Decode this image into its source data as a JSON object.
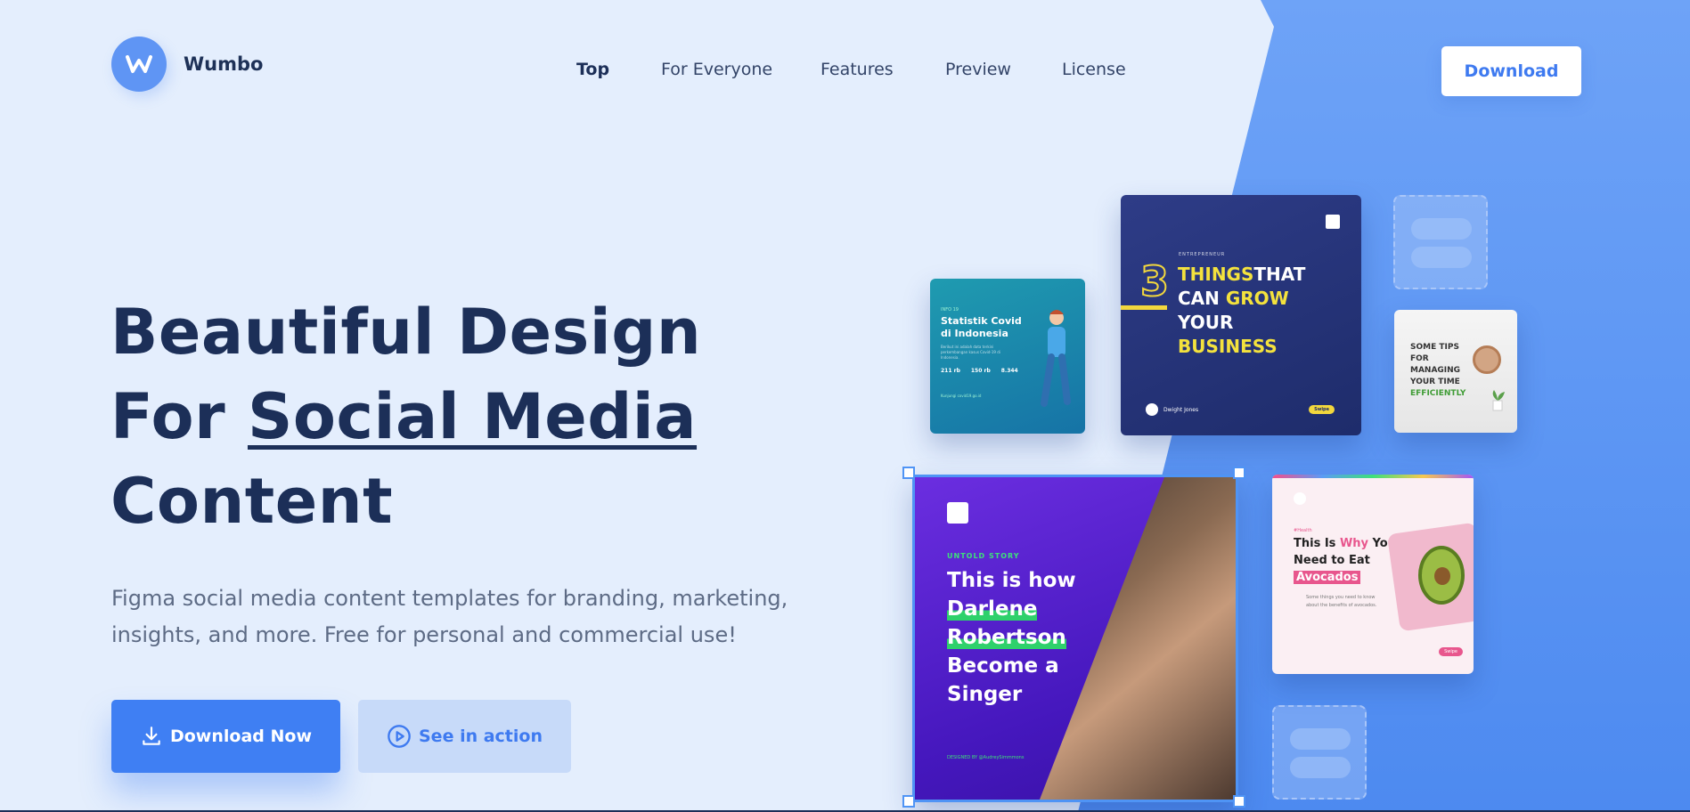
{
  "brand": {
    "name": "Wumbo",
    "logo_letter": "W"
  },
  "nav": [
    {
      "label": "Top",
      "active": true
    },
    {
      "label": "For Everyone",
      "active": false
    },
    {
      "label": "Features",
      "active": false
    },
    {
      "label": "Preview",
      "active": false
    },
    {
      "label": "License",
      "active": false
    }
  ],
  "header_button": "Download",
  "hero": {
    "line1": "Beautiful Design",
    "line2_prefix": "For ",
    "line2_emphasis": "Social Media",
    "line3": "Content",
    "description": "Figma social media content templates for branding, marketing, insights, and more. Free for personal and commercial use!"
  },
  "buttons": {
    "primary": "Download Now",
    "secondary": "See in action"
  },
  "cards": {
    "covid": {
      "kicker": "INFO 19",
      "title": "Statistik Covid di Indonesia",
      "sub": "Berikut ini adalah data terkini perkembangan kasus Covid-19 di Indonesia.",
      "stats": [
        "211 rb",
        "150 rb",
        "8.344"
      ],
      "source": "Kunjungi covid19.go.id"
    },
    "business": {
      "kicker": "ENTREPRENEUR",
      "number": "3",
      "line1a": "THINGS",
      "line1b": "THAT",
      "line2a": "CAN ",
      "line2b": "GROW",
      "line3": "YOUR",
      "line4": "BUSINESS",
      "author": "Dwight Jones",
      "swipe": "Swipe"
    },
    "tips": {
      "line1": "SOME TIPS",
      "line2": "FOR",
      "line3": "MANAGING",
      "line4": "YOUR TIME",
      "line5": "EFFICIENTLY"
    },
    "singer": {
      "kicker": "UNTOLD STORY",
      "l1": "This is how",
      "l2": "Darlene",
      "l3": "Robertson",
      "l4": "Become a",
      "l5": "Singer",
      "footer": "DESIGNED BY @AudreySimmmons"
    },
    "avocado": {
      "kicker": "#Health",
      "l1a": "This Is ",
      "l1b": "Why",
      "l1c": " You",
      "l2": "Need to Eat",
      "l3": "Avocados",
      "sub": "Some things you need to know about the benefits of avocados.",
      "swipe": "Swipe"
    }
  },
  "colors": {
    "accent": "#3f7ff3",
    "heading": "#1c2f58",
    "background": "#e4eefd",
    "panel": "#5b95f4"
  }
}
